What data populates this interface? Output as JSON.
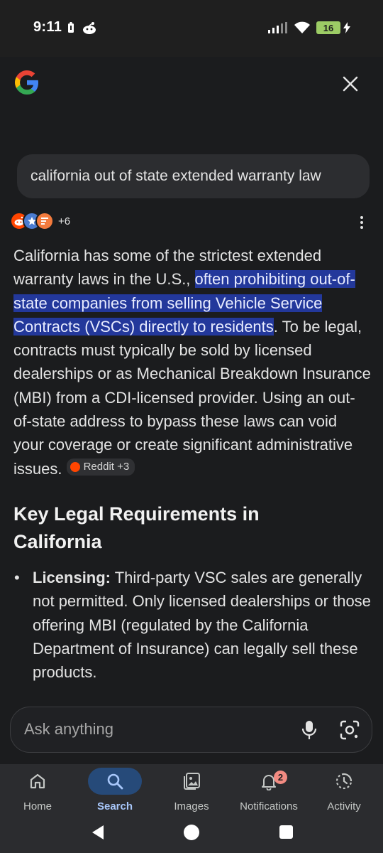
{
  "status_bar": {
    "time": "9:11",
    "battery_level": "16",
    "icons": [
      "battery-saver-icon",
      "notification-icon",
      "signal-icon",
      "wifi-icon",
      "battery-icon",
      "charging-icon"
    ]
  },
  "header": {
    "logo": "google-logo",
    "close_icon": "close-icon"
  },
  "query": {
    "text": "california out of state extended warranty law"
  },
  "sources": {
    "extra_count": "+6",
    "icons": [
      "reddit-icon",
      "star-badge-icon",
      "form-icon"
    ],
    "colors": [
      "#ff4500",
      "#4a7bd0",
      "#f47b3d"
    ]
  },
  "answer": {
    "part1": "California has some of the strictest extended warranty laws in the U.S., ",
    "highlight": "often prohibiting out-of-state companies from selling Vehicle Service Contracts (VSCs) directly to residents",
    "part2": ". To be legal, contracts must typically be sold by licensed dealerships or as Mechanical Breakdown Insurance (MBI) from a CDI-licensed provider. Using an out-of-state address to bypass these laws can void your coverage or create significant administrative issues. ",
    "citation": "Reddit +3"
  },
  "section": {
    "heading": "Key Legal Requirements in California"
  },
  "bullets": [
    {
      "title": "Licensing:",
      "text": " Third-party VSC sales are generally not permitted. Only licensed dealerships or those offering MBI (regulated by the California Department of Insurance) can legally sell these products."
    }
  ],
  "ask_bar": {
    "placeholder": "Ask anything"
  },
  "bottom_nav": {
    "items": [
      {
        "label": "Home",
        "icon": "home-icon",
        "active": false
      },
      {
        "label": "Search",
        "icon": "search-icon",
        "active": true
      },
      {
        "label": "Images",
        "icon": "images-icon",
        "active": false
      },
      {
        "label": "Notifications",
        "icon": "bell-icon",
        "active": false,
        "badge": "2"
      },
      {
        "label": "Activity",
        "icon": "activity-icon",
        "active": false
      }
    ]
  },
  "colors": {
    "background": "#1b1c1e",
    "highlight": "#23389b",
    "accent": "#a8c7fa",
    "nav_active_pill": "#264a79",
    "badge": "#f28b82"
  }
}
